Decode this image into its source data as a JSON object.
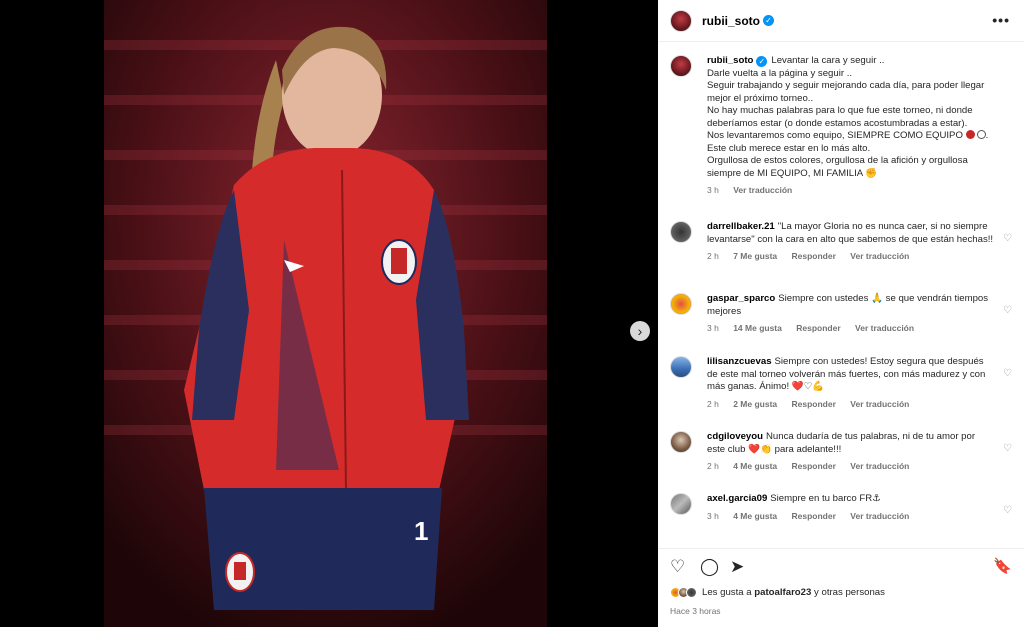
{
  "post": {
    "username": "rubii_soto",
    "caption": {
      "line1": "Levantar la cara y seguir ..",
      "line2": "Darle vuelta a la página y seguir ..",
      "line3": "Seguir trabajando y seguir mejorando cada día, para poder llegar mejor el próximo torneo..",
      "line4": "No hay muchas palabras para lo que fue este torneo, ni donde deberíamos estar (o donde estamos acostumbradas a estar).",
      "line5": "Nos levantaremos como equipo, SIEMPRE COMO EQUIPO",
      "line6": "Este club merece estar en lo más alto.",
      "line7": "Orgullosa de estos colores, orgullosa de la afición y orgullosa siempre de MI EQUIPO, MI FAMILIA ✊"
    },
    "time": "3 h",
    "translate": "Ver traducción",
    "likes_prefix": "Les gusta a",
    "likes_user": "patoalfaro23",
    "likes_suffix": "y otras personas",
    "posted_ago": "Hace 3 horas"
  },
  "comments": [
    {
      "user": "darrellbaker.21",
      "text": "\"La mayor Gloria no es nunca caer, si no siempre levantarse\" con la cara en alto que sabemos de que están hechas!!",
      "time": "2 h",
      "likes": "7 Me gusta",
      "reply": "Responder",
      "translate": "Ver traducción"
    },
    {
      "user": "gaspar_sparco",
      "text": "Siempre con ustedes 🙏 se que vendrán tiempos mejores",
      "time": "3 h",
      "likes": "14 Me gusta",
      "reply": "Responder",
      "translate": "Ver traducción"
    },
    {
      "user": "lilisanzcuevas",
      "text": "Siempre con ustedes! Estoy segura que después de este mal torneo volverán más fuertes, con más madurez y con más ganas. Ánimo! ❤️♡💪",
      "time": "2 h",
      "likes": "2 Me gusta",
      "reply": "Responder",
      "translate": "Ver traducción"
    },
    {
      "user": "cdgiloveyou",
      "text": "Nunca dudaría de tus palabras, ni de tu amor por este club ❤️👏 para adelante!!!",
      "time": "2 h",
      "likes": "4 Me gusta",
      "reply": "Responder",
      "translate": "Ver traducción"
    },
    {
      "user": "axel.garcia09",
      "text": "Siempre en tu barco FR⚓",
      "time": "3 h",
      "likes": "4 Me gusta",
      "reply": "Responder",
      "translate": "Ver traducción"
    }
  ],
  "icons": {
    "verified": "✓",
    "more": "•••",
    "next": "›",
    "heart_small": "♡",
    "like": "♡",
    "comment": "◯",
    "share": "➤",
    "save": "🔖"
  },
  "colors": {
    "accent": "#0095f6",
    "jersey_red": "#c62828"
  }
}
